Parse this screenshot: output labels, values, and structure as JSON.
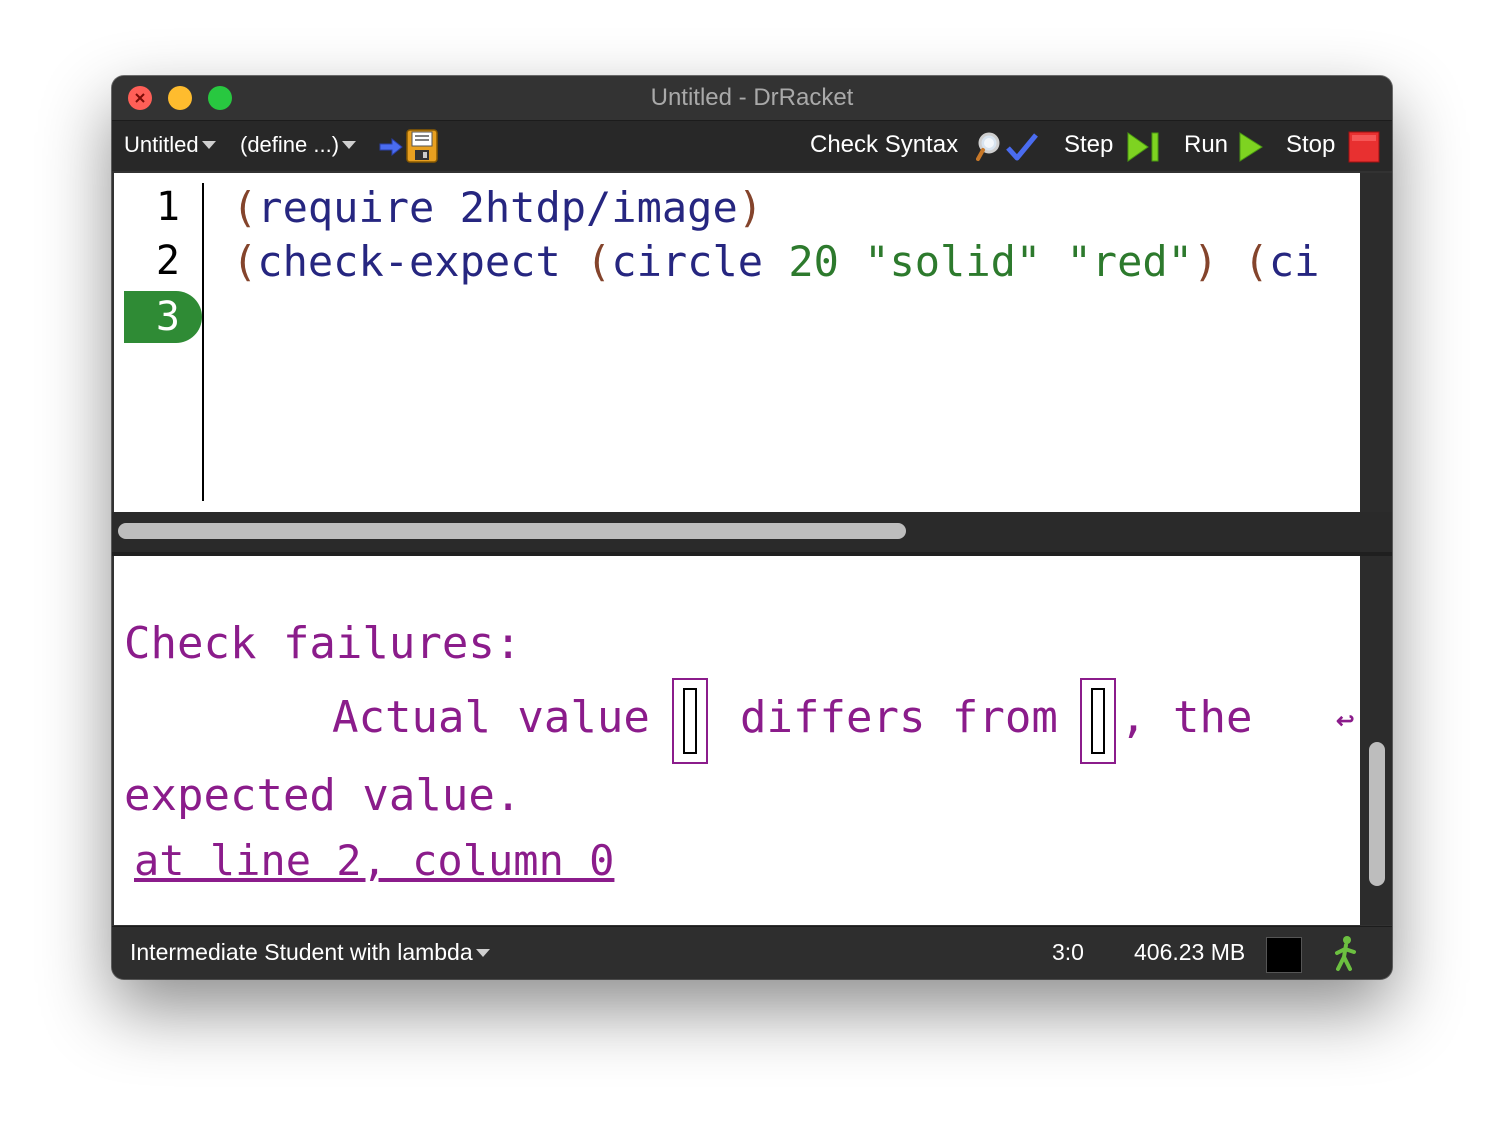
{
  "window": {
    "title": "Untitled - DrRacket"
  },
  "toolbar": {
    "file_menu": "Untitled",
    "define_menu": "(define ...)",
    "check_syntax": "Check Syntax",
    "step": "Step",
    "run": "Run",
    "stop": "Stop"
  },
  "editor": {
    "line_numbers": [
      "1",
      "2",
      "3"
    ],
    "active_line": "3",
    "line1": {
      "open": "(",
      "body": "require 2htdp/image",
      "close": ")"
    },
    "line2": {
      "open1": "(",
      "kw": "check-expect ",
      "open2": "(",
      "fn": "circle ",
      "num": "20 ",
      "str1": "\"solid\"",
      "sp": " ",
      "str2": "\"red\"",
      "close": ")",
      "gap": " ",
      "open3": "(",
      "rest": "ci"
    }
  },
  "interactions": {
    "heading": "Check failures:",
    "actual": "Actual value",
    "differs": "differs from",
    "comma_the": ", the",
    "expected": "expected value.",
    "location": "at line 2, column 0",
    "wrap_marker": "↩"
  },
  "status": {
    "language": "Intermediate Student with lambda",
    "position": "3:0",
    "memory": "406.23 MB"
  },
  "colors": {
    "error": "#8b1c8b",
    "keyword": "#262680",
    "paren": "#84442c",
    "literal": "#2d7a2d",
    "active_line": "#2f8b35"
  }
}
